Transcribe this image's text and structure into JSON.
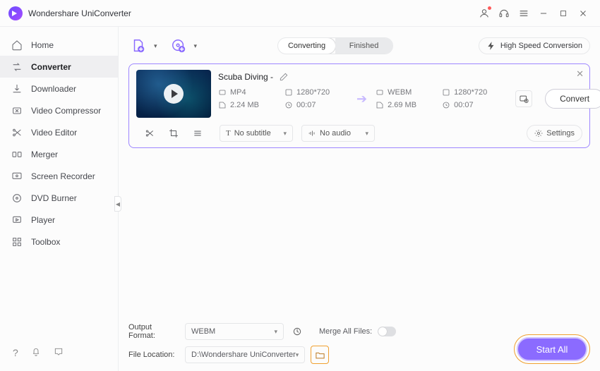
{
  "titlebar": {
    "app": "Wondershare UniConverter"
  },
  "sidebar": {
    "items": [
      {
        "label": "Home"
      },
      {
        "label": "Converter"
      },
      {
        "label": "Downloader"
      },
      {
        "label": "Video Compressor"
      },
      {
        "label": "Video Editor"
      },
      {
        "label": "Merger"
      },
      {
        "label": "Screen Recorder"
      },
      {
        "label": "DVD Burner"
      },
      {
        "label": "Player"
      },
      {
        "label": "Toolbox"
      }
    ]
  },
  "tabs": {
    "converting": "Converting",
    "finished": "Finished"
  },
  "hsconv": "High Speed Conversion",
  "item": {
    "title": "Scuba Diving",
    "title_suffix": " - ",
    "src": {
      "format": "MP4",
      "res": "1280*720",
      "size": "2.24 MB",
      "dur": "00:07"
    },
    "dst": {
      "format": "WEBM",
      "res": "1280*720",
      "size": "2.69 MB",
      "dur": "00:07"
    },
    "subtitle": "No subtitle",
    "audio": "No audio",
    "settings": "Settings",
    "convert": "Convert"
  },
  "footer": {
    "outputFormatLabel": "Output Format:",
    "outputFormat": "WEBM",
    "fileLocationLabel": "File Location:",
    "fileLocation": "D:\\Wondershare UniConverter",
    "mergeLabel": "Merge All Files:",
    "startAll": "Start All"
  }
}
